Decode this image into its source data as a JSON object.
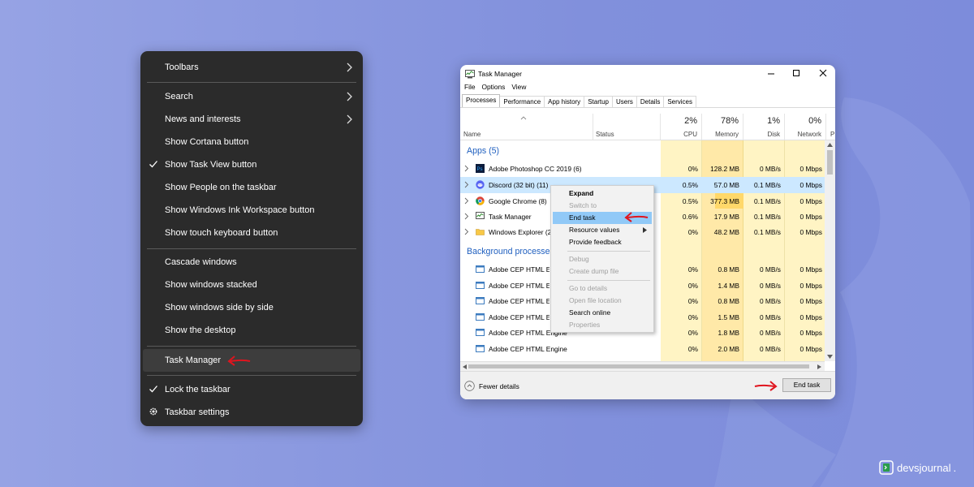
{
  "taskbar_menu": {
    "items": [
      {
        "label": "Toolbars",
        "submenu": true
      },
      {
        "label": "Search",
        "submenu": true
      },
      {
        "label": "News and interests",
        "submenu": true
      },
      {
        "label": "Show Cortana button"
      },
      {
        "label": "Show Task View button",
        "checked": true
      },
      {
        "label": "Show People on the taskbar"
      },
      {
        "label": "Show Windows Ink Workspace button"
      },
      {
        "label": "Show touch keyboard button"
      },
      {
        "label": "Cascade windows"
      },
      {
        "label": "Show windows stacked"
      },
      {
        "label": "Show windows side by side"
      },
      {
        "label": "Show the desktop"
      },
      {
        "label": "Task Manager",
        "highlighted": true
      },
      {
        "label": "Lock the taskbar",
        "checked": true
      },
      {
        "label": "Taskbar settings",
        "icon": "gear-icon"
      }
    ]
  },
  "task_manager": {
    "title": "Task Manager",
    "menu": [
      "File",
      "Options",
      "View"
    ],
    "tabs": [
      "Processes",
      "Performance",
      "App history",
      "Startup",
      "Users",
      "Details",
      "Services"
    ],
    "active_tab": "Processes",
    "columns": {
      "name": "Name",
      "status": "Status",
      "cpu": {
        "pct": "2%",
        "label": "CPU"
      },
      "memory": {
        "pct": "78%",
        "label": "Memory"
      },
      "disk": {
        "pct": "1%",
        "label": "Disk"
      },
      "network": {
        "pct": "0%",
        "label": "Network"
      },
      "power": {
        "label": "P"
      }
    },
    "groups": {
      "apps": "Apps (5)",
      "background": "Background processes"
    },
    "apps": [
      {
        "name": "Adobe Photoshop CC 2019 (6)",
        "icon": "photoshop-icon",
        "cpu": "0%",
        "memory": "128.2 MB",
        "disk": "0 MB/s",
        "network": "0 Mbps"
      },
      {
        "name": "Discord (32 bit) (11)",
        "icon": "discord-icon",
        "cpu": "0.5%",
        "memory": "57.0 MB",
        "disk": "0.1 MB/s",
        "network": "0 Mbps",
        "selected": true
      },
      {
        "name": "Google Chrome (8)",
        "icon": "chrome-icon",
        "cpu": "0.5%",
        "memory": "377.3 MB",
        "disk": "0.1 MB/s",
        "network": "0 Mbps"
      },
      {
        "name": "Task Manager",
        "icon": "task-manager-icon",
        "cpu": "0.6%",
        "memory": "17.9 MB",
        "disk": "0.1 MB/s",
        "network": "0 Mbps"
      },
      {
        "name": "Windows Explorer (2",
        "icon": "folder-icon",
        "cpu": "0%",
        "memory": "48.2 MB",
        "disk": "0.1 MB/s",
        "network": "0 Mbps"
      }
    ],
    "background": [
      {
        "name": "Adobe CEP HTML Er",
        "cpu": "0%",
        "memory": "0.8 MB",
        "disk": "0 MB/s",
        "network": "0 Mbps"
      },
      {
        "name": "Adobe CEP HTML Er",
        "cpu": "0%",
        "memory": "1.4 MB",
        "disk": "0 MB/s",
        "network": "0 Mbps"
      },
      {
        "name": "Adobe CEP HTML Er",
        "cpu": "0%",
        "memory": "0.8 MB",
        "disk": "0 MB/s",
        "network": "0 Mbps"
      },
      {
        "name": "Adobe CEP HTML Er",
        "cpu": "0%",
        "memory": "1.5 MB",
        "disk": "0 MB/s",
        "network": "0 Mbps"
      },
      {
        "name": "Adobe CEP HTML Engine",
        "cpu": "0%",
        "memory": "1.8 MB",
        "disk": "0 MB/s",
        "network": "0 Mbps"
      },
      {
        "name": "Adobe CEP HTML Engine",
        "cpu": "0%",
        "memory": "2.0 MB",
        "disk": "0 MB/s",
        "network": "0 Mbps"
      }
    ],
    "footer": {
      "fewer_details": "Fewer details",
      "end_task": "End task"
    }
  },
  "process_menu": {
    "items": [
      {
        "label": "Expand",
        "bold": true
      },
      {
        "label": "Switch to",
        "disabled": true
      },
      {
        "label": "End task",
        "highlighted": true
      },
      {
        "label": "Resource values",
        "submenu": true
      },
      {
        "label": "Provide feedback"
      },
      {
        "label": "Debug",
        "disabled": true
      },
      {
        "label": "Create dump file",
        "disabled": true
      },
      {
        "label": "Go to details",
        "disabled": true
      },
      {
        "label": "Open file location",
        "disabled": true
      },
      {
        "label": "Search online"
      },
      {
        "label": "Properties",
        "disabled": true
      }
    ]
  },
  "brand": {
    "name": "devsjournal",
    "suffix": "."
  },
  "colors": {
    "background": "#8a97de",
    "menu_bg": "#2b2b2b",
    "arrow": "#e0141e",
    "accent_blue": "#1f5fbf",
    "selection": "#cce8ff",
    "heat_light": "#fff4c4",
    "heat_strong": "#ffe38a"
  }
}
